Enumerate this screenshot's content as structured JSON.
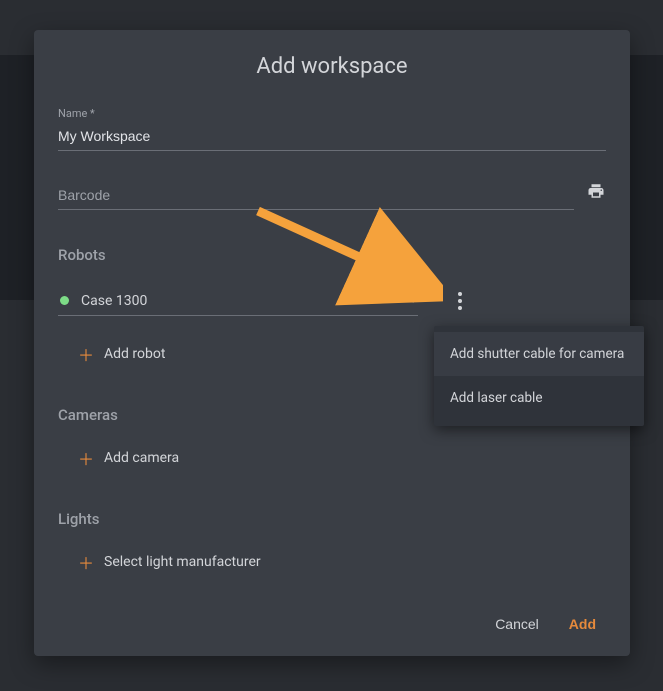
{
  "dialog": {
    "title": "Add workspace",
    "name_label": "Name *",
    "name_value": "My Workspace",
    "barcode_placeholder": "Barcode",
    "barcode_value": ""
  },
  "robots": {
    "heading": "Robots",
    "selected": "Case 1300",
    "status_color": "#7ddc87",
    "add_label": "Add robot"
  },
  "cameras": {
    "heading": "Cameras",
    "add_label": "Add camera"
  },
  "lights": {
    "heading": "Lights",
    "add_label": "Select light manufacturer"
  },
  "actions": {
    "cancel": "Cancel",
    "add": "Add"
  },
  "menu": {
    "items": [
      "Add shutter cable for camera",
      "Add laser cable"
    ]
  },
  "colors": {
    "accent": "#e68a3c"
  }
}
